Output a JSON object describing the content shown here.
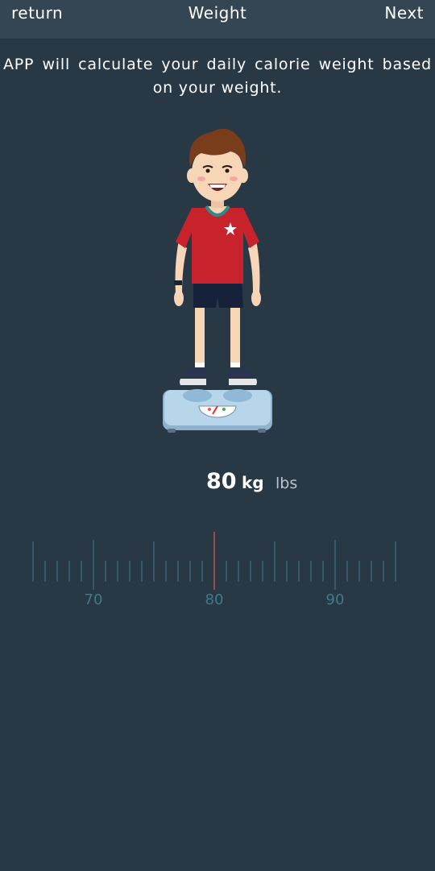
{
  "header": {
    "return_label": "return",
    "title": "Weight",
    "next_label": "Next"
  },
  "description": "APP will calculate your daily calorie weight based on your weight.",
  "weight": {
    "value": "80",
    "unit_selected": "kg",
    "unit_alt": "lbs"
  },
  "ruler": {
    "min": 65,
    "max": 95,
    "step": 1,
    "selected": 80,
    "labels": [
      "70",
      "80",
      "90"
    ],
    "tick_color": "#3e7a8c",
    "indicator_color": "#c0504d"
  },
  "colors": {
    "background": "#293845",
    "header": "#344553"
  },
  "icons": {
    "illustration": "boy-on-scale-illustration"
  }
}
